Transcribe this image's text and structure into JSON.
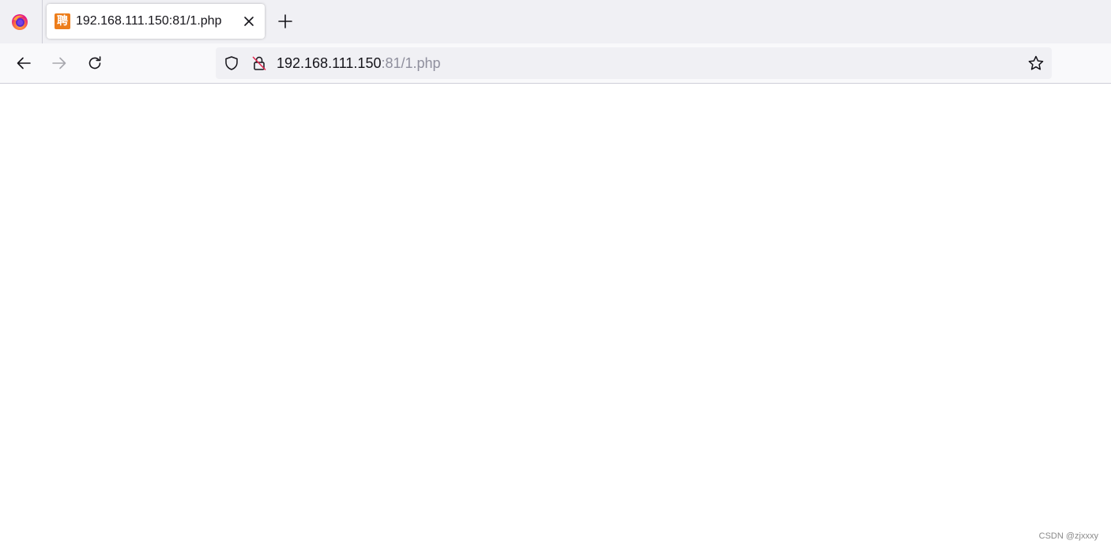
{
  "browser": {
    "icons": {
      "logo": "firefox-logo-icon",
      "close": "close-icon",
      "new_tab": "plus-icon",
      "back": "arrow-left-icon",
      "forward": "arrow-right-icon",
      "reload": "reload-icon",
      "shield": "shield-icon",
      "insecure": "insecure-lock-icon",
      "bookmark": "star-icon"
    }
  },
  "tab": {
    "favicon_glyph": "聘",
    "favicon_color": "#ed7d1a",
    "title": "192.168.111.150:81/1.php"
  },
  "urlbar": {
    "host": "192.168.111.150",
    "rest": ":81/1.php"
  },
  "page": {
    "watermark": "CSDN @zjxxxy"
  }
}
